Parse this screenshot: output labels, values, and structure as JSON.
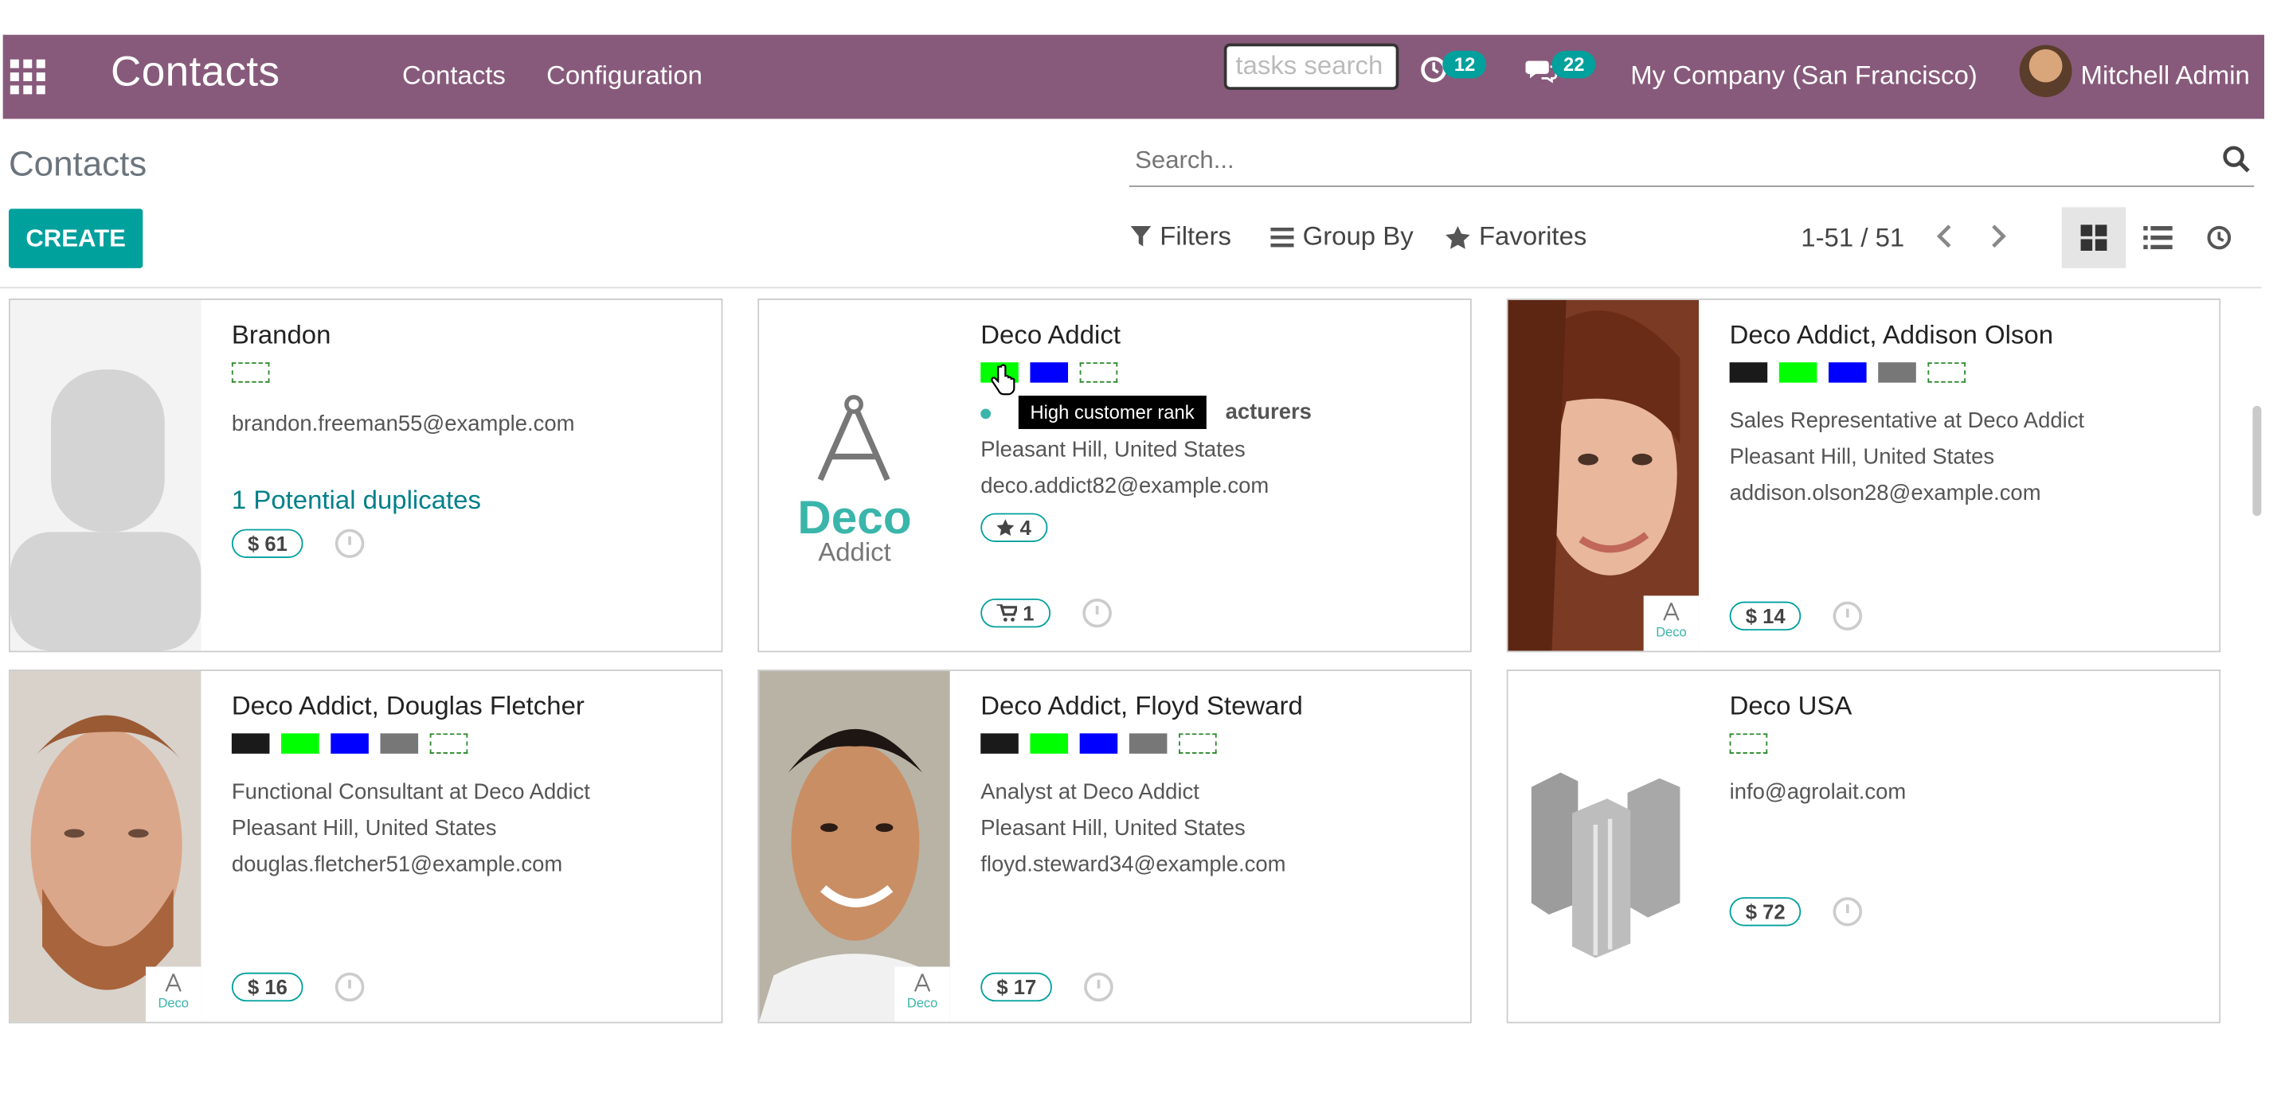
{
  "navbar": {
    "brand": "Contacts",
    "menu": [
      "Contacts",
      "Configuration"
    ],
    "tasks_search_placeholder": "tasks search",
    "activities_count": "12",
    "messages_count": "22",
    "company": "My Company (San Francisco)",
    "user": "Mitchell Admin"
  },
  "control_panel": {
    "breadcrumb": "Contacts",
    "search_placeholder": "Search...",
    "create_label": "CREATE",
    "filters_label": "Filters",
    "groupby_label": "Group By",
    "favorites_label": "Favorites",
    "pager": "1-51 / 51"
  },
  "tooltip": "High customer rank",
  "cards": [
    {
      "name": "Brandon",
      "email": "brandon.freeman55@example.com",
      "duplicates": "1 Potential duplicates",
      "sales": "$ 61"
    },
    {
      "name": "Deco Addict",
      "category_text": "acturers",
      "location": "Pleasant Hill, United States",
      "email": "deco.addict82@example.com",
      "rank": "4",
      "cart": "1",
      "logo_big": "Deco",
      "logo_small": "Addict"
    },
    {
      "name": "Deco Addict, Addison Olson",
      "function": "Sales Representative at Deco Addict",
      "location": "Pleasant Hill, United States",
      "email": "addison.olson28@example.com",
      "sales": "$ 14"
    },
    {
      "name": "Deco Addict, Douglas Fletcher",
      "function": "Functional Consultant at Deco Addict",
      "location": "Pleasant Hill, United States",
      "email": "douglas.fletcher51@example.com",
      "sales": "$ 16"
    },
    {
      "name": "Deco Addict, Floyd Steward",
      "function": "Analyst at Deco Addict",
      "location": "Pleasant Hill, United States",
      "email": "floyd.steward34@example.com",
      "sales": "$ 17"
    },
    {
      "name": "Deco USA",
      "email": "info@agrolait.com",
      "sales": "$ 72"
    }
  ],
  "mini_logo": {
    "big": "Deco",
    "small": "Addict"
  },
  "colors": {
    "brand": "#875a7b",
    "accent": "#00a09d",
    "tag_black": "#1a1a1a",
    "tag_green": "#00ff00",
    "tag_blue": "#0000ff",
    "tag_gray": "#777777"
  }
}
